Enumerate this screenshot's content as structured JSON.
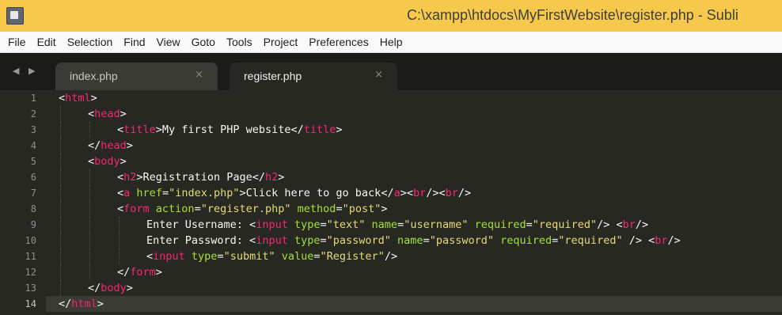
{
  "window": {
    "title": "C:\\xampp\\htdocs\\MyFirstWebsite\\register.php - Subli"
  },
  "menu": {
    "items": [
      "File",
      "Edit",
      "Selection",
      "Find",
      "View",
      "Goto",
      "Tools",
      "Project",
      "Preferences",
      "Help"
    ]
  },
  "tabs": [
    {
      "label": "index.php",
      "close": "×",
      "active": false
    },
    {
      "label": "register.php",
      "close": "×",
      "active": true
    }
  ],
  "nav_arrows": "◀ ▶",
  "editor": {
    "current_line": 14,
    "theme_colors": {
      "background": "#272822",
      "tag": "#f92672",
      "attribute": "#a6e22e",
      "string": "#e6db74",
      "text": "#f8f8f2"
    },
    "lines": [
      {
        "n": "1",
        "indent": 0,
        "tokens": [
          [
            "p",
            "<"
          ],
          [
            "t",
            "html"
          ],
          [
            "p",
            ">"
          ]
        ]
      },
      {
        "n": "2",
        "indent": 1,
        "tokens": [
          [
            "p",
            "<"
          ],
          [
            "t",
            "head"
          ],
          [
            "p",
            ">"
          ]
        ]
      },
      {
        "n": "3",
        "indent": 2,
        "tokens": [
          [
            "p",
            "<"
          ],
          [
            "t",
            "title"
          ],
          [
            "p",
            ">"
          ],
          [
            "x",
            "My first PHP website"
          ],
          [
            "p",
            "</"
          ],
          [
            "t",
            "title"
          ],
          [
            "p",
            ">"
          ]
        ]
      },
      {
        "n": "4",
        "indent": 1,
        "tokens": [
          [
            "p",
            "</"
          ],
          [
            "t",
            "head"
          ],
          [
            "p",
            ">"
          ]
        ]
      },
      {
        "n": "5",
        "indent": 1,
        "tokens": [
          [
            "p",
            "<"
          ],
          [
            "t",
            "body"
          ],
          [
            "p",
            ">"
          ]
        ]
      },
      {
        "n": "6",
        "indent": 2,
        "tokens": [
          [
            "p",
            "<"
          ],
          [
            "t",
            "h2"
          ],
          [
            "p",
            ">"
          ],
          [
            "x",
            "Registration Page"
          ],
          [
            "p",
            "</"
          ],
          [
            "t",
            "h2"
          ],
          [
            "p",
            ">"
          ]
        ]
      },
      {
        "n": "7",
        "indent": 2,
        "tokens": [
          [
            "p",
            "<"
          ],
          [
            "t",
            "a"
          ],
          [
            "x",
            " "
          ],
          [
            "a",
            "href"
          ],
          [
            "p",
            "="
          ],
          [
            "s",
            "\"index.php\""
          ],
          [
            "p",
            ">"
          ],
          [
            "x",
            "Click here to go back"
          ],
          [
            "p",
            "</"
          ],
          [
            "t",
            "a"
          ],
          [
            "p",
            "><"
          ],
          [
            "t",
            "br"
          ],
          [
            "p",
            "/><"
          ],
          [
            "t",
            "br"
          ],
          [
            "p",
            "/>"
          ]
        ]
      },
      {
        "n": "8",
        "indent": 2,
        "tokens": [
          [
            "p",
            "<"
          ],
          [
            "t",
            "form"
          ],
          [
            "x",
            " "
          ],
          [
            "a",
            "action"
          ],
          [
            "p",
            "="
          ],
          [
            "s",
            "\"register.php\""
          ],
          [
            "x",
            " "
          ],
          [
            "a",
            "method"
          ],
          [
            "p",
            "="
          ],
          [
            "s",
            "\"post\""
          ],
          [
            "p",
            ">"
          ]
        ]
      },
      {
        "n": "9",
        "indent": 3,
        "tokens": [
          [
            "x",
            "Enter Username: "
          ],
          [
            "p",
            "<"
          ],
          [
            "t",
            "input"
          ],
          [
            "x",
            " "
          ],
          [
            "a",
            "type"
          ],
          [
            "p",
            "="
          ],
          [
            "s",
            "\"text\""
          ],
          [
            "x",
            " "
          ],
          [
            "a",
            "name"
          ],
          [
            "p",
            "="
          ],
          [
            "s",
            "\"username\""
          ],
          [
            "x",
            " "
          ],
          [
            "a",
            "required"
          ],
          [
            "p",
            "="
          ],
          [
            "s",
            "\"required\""
          ],
          [
            "p",
            "/>"
          ],
          [
            "x",
            " "
          ],
          [
            "p",
            "<"
          ],
          [
            "t",
            "br"
          ],
          [
            "p",
            "/>"
          ]
        ]
      },
      {
        "n": "10",
        "indent": 3,
        "tokens": [
          [
            "x",
            "Enter Password: "
          ],
          [
            "p",
            "<"
          ],
          [
            "t",
            "input"
          ],
          [
            "x",
            " "
          ],
          [
            "a",
            "type"
          ],
          [
            "p",
            "="
          ],
          [
            "s",
            "\"password\""
          ],
          [
            "x",
            " "
          ],
          [
            "a",
            "name"
          ],
          [
            "p",
            "="
          ],
          [
            "s",
            "\"password\""
          ],
          [
            "x",
            " "
          ],
          [
            "a",
            "required"
          ],
          [
            "p",
            "="
          ],
          [
            "s",
            "\"required\""
          ],
          [
            "x",
            " "
          ],
          [
            "p",
            "/>"
          ],
          [
            "x",
            " "
          ],
          [
            "p",
            "<"
          ],
          [
            "t",
            "br"
          ],
          [
            "p",
            "/>"
          ]
        ]
      },
      {
        "n": "11",
        "indent": 3,
        "tokens": [
          [
            "p",
            "<"
          ],
          [
            "t",
            "input"
          ],
          [
            "x",
            " "
          ],
          [
            "a",
            "type"
          ],
          [
            "p",
            "="
          ],
          [
            "s",
            "\"submit\""
          ],
          [
            "x",
            " "
          ],
          [
            "a",
            "value"
          ],
          [
            "p",
            "="
          ],
          [
            "s",
            "\"Register\""
          ],
          [
            "p",
            "/>"
          ]
        ]
      },
      {
        "n": "12",
        "indent": 2,
        "tokens": [
          [
            "p",
            "</"
          ],
          [
            "t",
            "form"
          ],
          [
            "p",
            ">"
          ]
        ]
      },
      {
        "n": "13",
        "indent": 1,
        "tokens": [
          [
            "p",
            "</"
          ],
          [
            "t",
            "body"
          ],
          [
            "p",
            ">"
          ]
        ]
      },
      {
        "n": "14",
        "indent": 0,
        "tokens": [
          [
            "p",
            "</"
          ],
          [
            "t",
            "html"
          ],
          [
            "p",
            ">"
          ]
        ]
      }
    ]
  }
}
